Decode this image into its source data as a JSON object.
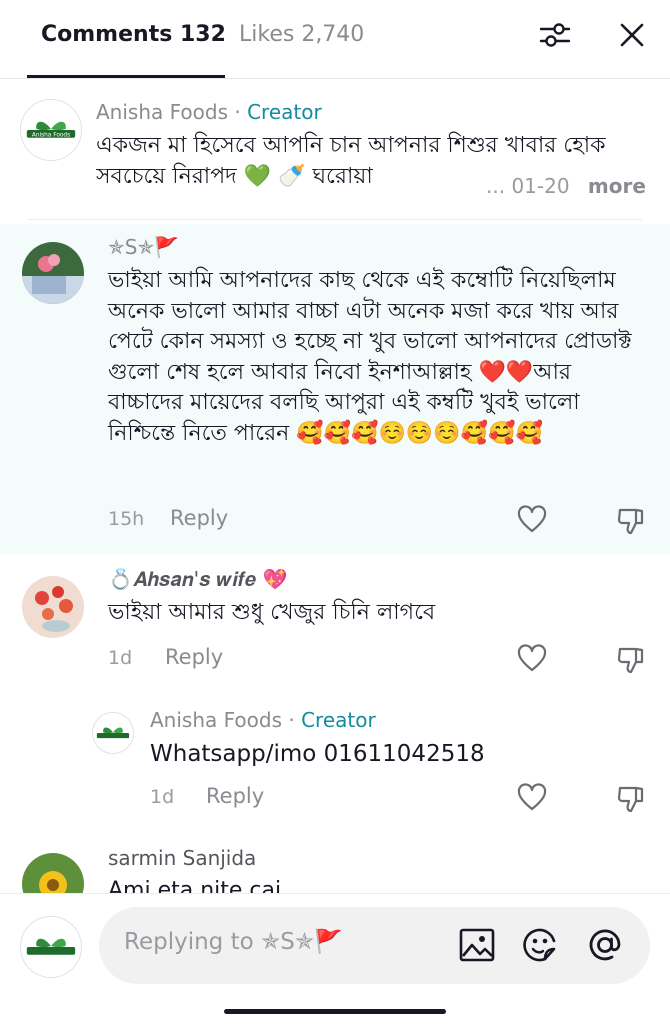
{
  "tabs": {
    "comments": "Comments 132",
    "likes": "Likes 2,740"
  },
  "icons": {
    "filter": "sliders-icon",
    "close": "close-icon",
    "like": "heart-outline-icon",
    "dislike": "thumbs-down-icon",
    "image": "image-icon",
    "emoji": "emoji-icon",
    "mention": "at-icon"
  },
  "colors": {
    "creator": "#138ba0",
    "pinned_bg": "#f4fbfb",
    "secondary_text": "#8a8b91"
  },
  "comments": [
    {
      "name": "Anisha Foods",
      "dot": " · ",
      "badge": "Creator",
      "text": "একজন মা হিসেবে আপনি চান আপনার শিশুর খাবার হোক সবচেয়ে নিরাপদ 💚 🍼 ঘরোয়া",
      "ellipsis": "...",
      "time": "01-20",
      "more": "more",
      "avatar_text": "Anisha Foods"
    },
    {
      "name": "✯S✯🚩",
      "text": "ভাইয়া আমি আপনাদের কাছ থেকে এই কম্বোটি নিয়েছিলাম অনেক ভালো আমার বাচ্চা এটা অনেক মজা করে খায় আর পেটে কোন সমস্যা ও হচ্ছে না খুব ভালো আপনাদের প্রোডাক্ট গুলো শেষ হলে আবার নিবো ইনশাআল্লাহ ❤️❤️আর বাচ্চাদের মায়েদের বলছি আপুরা এই কম্বটি খুবই ভালো নিশ্চিন্তে নিতে পারেন 🥰🥰🥰☺️☺️☺️🥰🥰🥰",
      "time": "15h",
      "reply": "Reply"
    },
    {
      "name": "💍𝑨𝒉𝒔𝒂𝒏'𝒔 𝒘𝒊𝒇𝒆 💖",
      "text": "ভাইয়া আমার শুধু খেজুর চিনি লাগবে",
      "time": "1d",
      "reply": "Reply",
      "reply_item": {
        "name": "Anisha Foods",
        "dot": " · ",
        "badge": "Creator",
        "text": "Whatsapp/imo 01611042518",
        "time": "1d",
        "reply": "Reply"
      }
    },
    {
      "name": "sarmin Sanjida",
      "text": "Ami eta nite cai"
    }
  ],
  "composer": {
    "placeholder": "Replying to ✯S✯🚩"
  }
}
